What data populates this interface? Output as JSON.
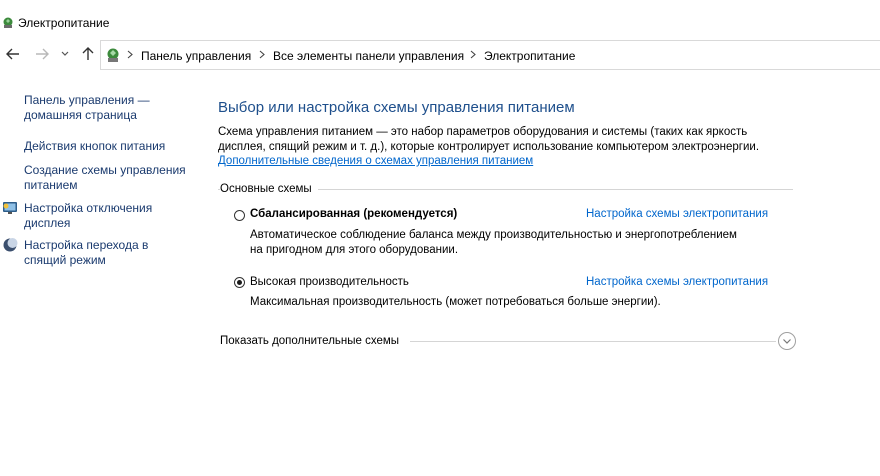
{
  "window": {
    "title": "Электропитание"
  },
  "nav": {
    "breadcrumbs": [
      "Панель управления",
      "Все элементы панели управления",
      "Электропитание"
    ]
  },
  "sidebar": {
    "items": [
      {
        "label_line1": "Панель управления —",
        "label_line2": "домашняя страница"
      },
      {
        "label_line1": "Действия кнопок питания"
      },
      {
        "label_line1": "Создание схемы управления",
        "label_line2": "питанием"
      },
      {
        "label_line1": "Настройка отключения",
        "label_line2": "дисплея",
        "icon": "display-icon"
      },
      {
        "label_line1": "Настройка перехода в",
        "label_line2": "спящий режим",
        "icon": "moon-icon"
      }
    ]
  },
  "main": {
    "heading": "Выбор или настройка схемы управления питанием",
    "description_line1": "Схема управления питанием — это набор параметров оборудования и системы (таких как яркость",
    "description_line2": "дисплея, спящий режим и т. д.), которые контролирует использование компьютером электроэнергии.",
    "more_info_link": "Дополнительные сведения о схемах управления питанием",
    "group_label": "Основные схемы",
    "plans": [
      {
        "name": "Сбалансированная (рекомендуется)",
        "selected": false,
        "desc_line1": "Автоматическое соблюдение баланса между производительностью и энергопотреблением",
        "desc_line2": "на пригодном для этого оборудовании.",
        "link": "Настройка схемы электропитания"
      },
      {
        "name": "Высокая производительность",
        "selected": true,
        "desc_line1": "Максимальная производительность (может потребоваться больше энергии).",
        "link": "Настройка схемы электропитания"
      }
    ],
    "show_more_label": "Показать дополнительные схемы"
  }
}
